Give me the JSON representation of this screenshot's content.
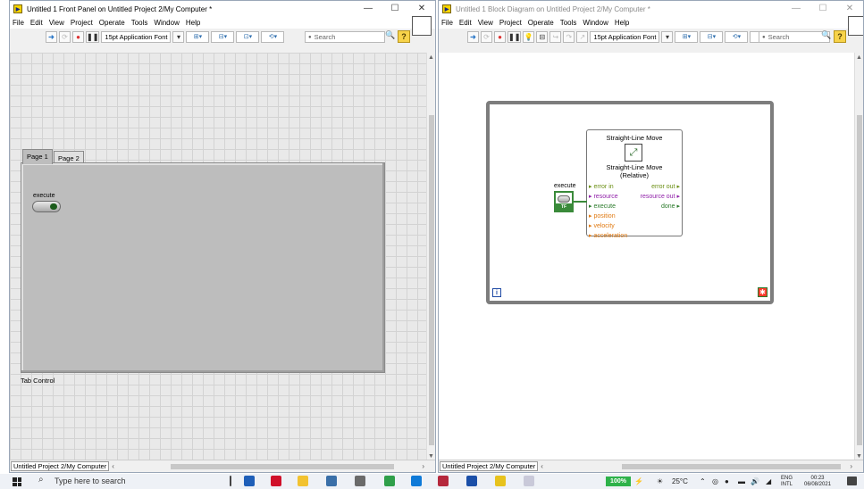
{
  "front_panel": {
    "title": "Untitled 1 Front Panel on Untitled Project 2/My Computer *",
    "menu": [
      "File",
      "Edit",
      "View",
      "Project",
      "Operate",
      "Tools",
      "Window",
      "Help"
    ],
    "font_selector": "15pt Application Font",
    "search_placeholder": "Search",
    "tabs": [
      {
        "label": "Page 1",
        "selected": true
      },
      {
        "label": "Page 2",
        "selected": false
      }
    ],
    "tab_control_caption": "Tab Control",
    "boolean_label": "execute",
    "status_context": "Untitled Project 2/My Computer"
  },
  "block_diagram": {
    "title": "Untitled 1 Block Diagram on Untitled Project 2/My Computer *",
    "menu": [
      "File",
      "Edit",
      "View",
      "Project",
      "Operate",
      "Tools",
      "Window",
      "Help"
    ],
    "font_selector": "15pt Application Font",
    "search_placeholder": "Search",
    "vi_node": {
      "title": "Straight-Line Move",
      "subtitle_line1": "Straight-Line Move",
      "subtitle_line2": "(Relative)",
      "inputs": [
        "error in",
        "resource",
        "execute",
        "position",
        "velocity",
        "acceleration"
      ],
      "outputs": [
        "error out",
        "resource out",
        "done"
      ]
    },
    "control_label": "execute",
    "control_type": "TF",
    "iteration_terminal": "i",
    "status_context": "Untitled Project 2/My Computer"
  },
  "window_controls": {
    "minimize": "—",
    "maximize": "☐",
    "close": "✕"
  },
  "taskbar": {
    "search_placeholder": "Type here to search",
    "battery": "100%",
    "temperature": "25°C",
    "language_line1": "ENG",
    "language_line2": "INTL",
    "time": "00:23",
    "date": "06/08/2021"
  },
  "colors": {
    "boolean_wire": "#3a8a3a",
    "error_cluster": "#6a8e12",
    "resource": "#8f1fa8",
    "numeric": "#e07a12"
  }
}
